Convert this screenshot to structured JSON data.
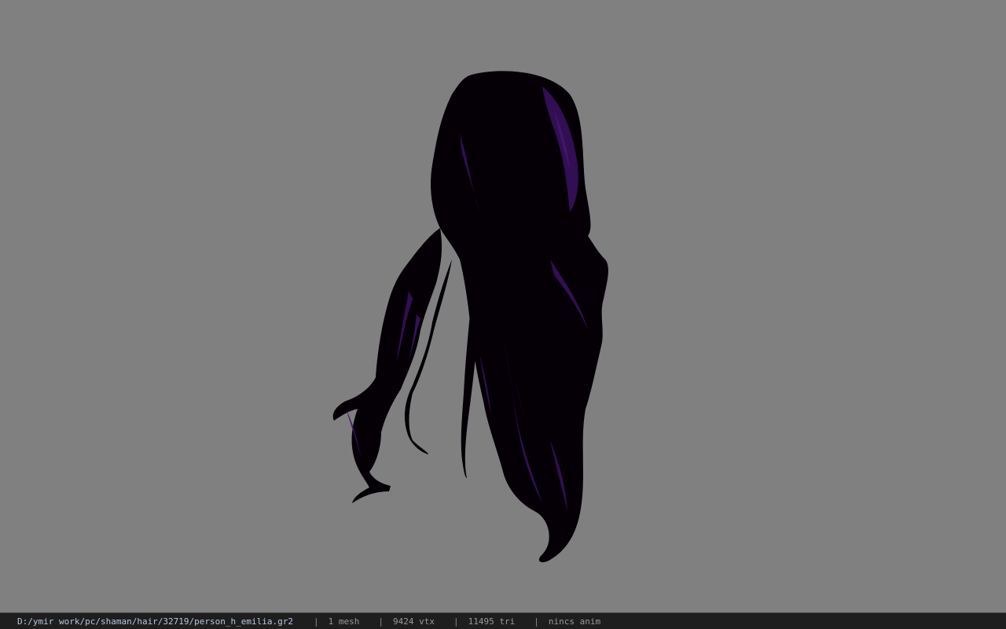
{
  "viewer": {
    "background_color": "#808080",
    "model_description": "hair mesh",
    "model_colors": {
      "base": "#050008",
      "highlight": "#3a1260",
      "highlight_bright": "#4a1a78"
    }
  },
  "status_bar": {
    "file_path": "D:/ymir work/pc/shaman/hair/32719/person_h_emilia.gr2",
    "separator": "|",
    "mesh_count": "1 mesh",
    "vertex_count": "9424 vtx",
    "triangle_count": "11495 tri",
    "anim_status": "nincs anim"
  }
}
